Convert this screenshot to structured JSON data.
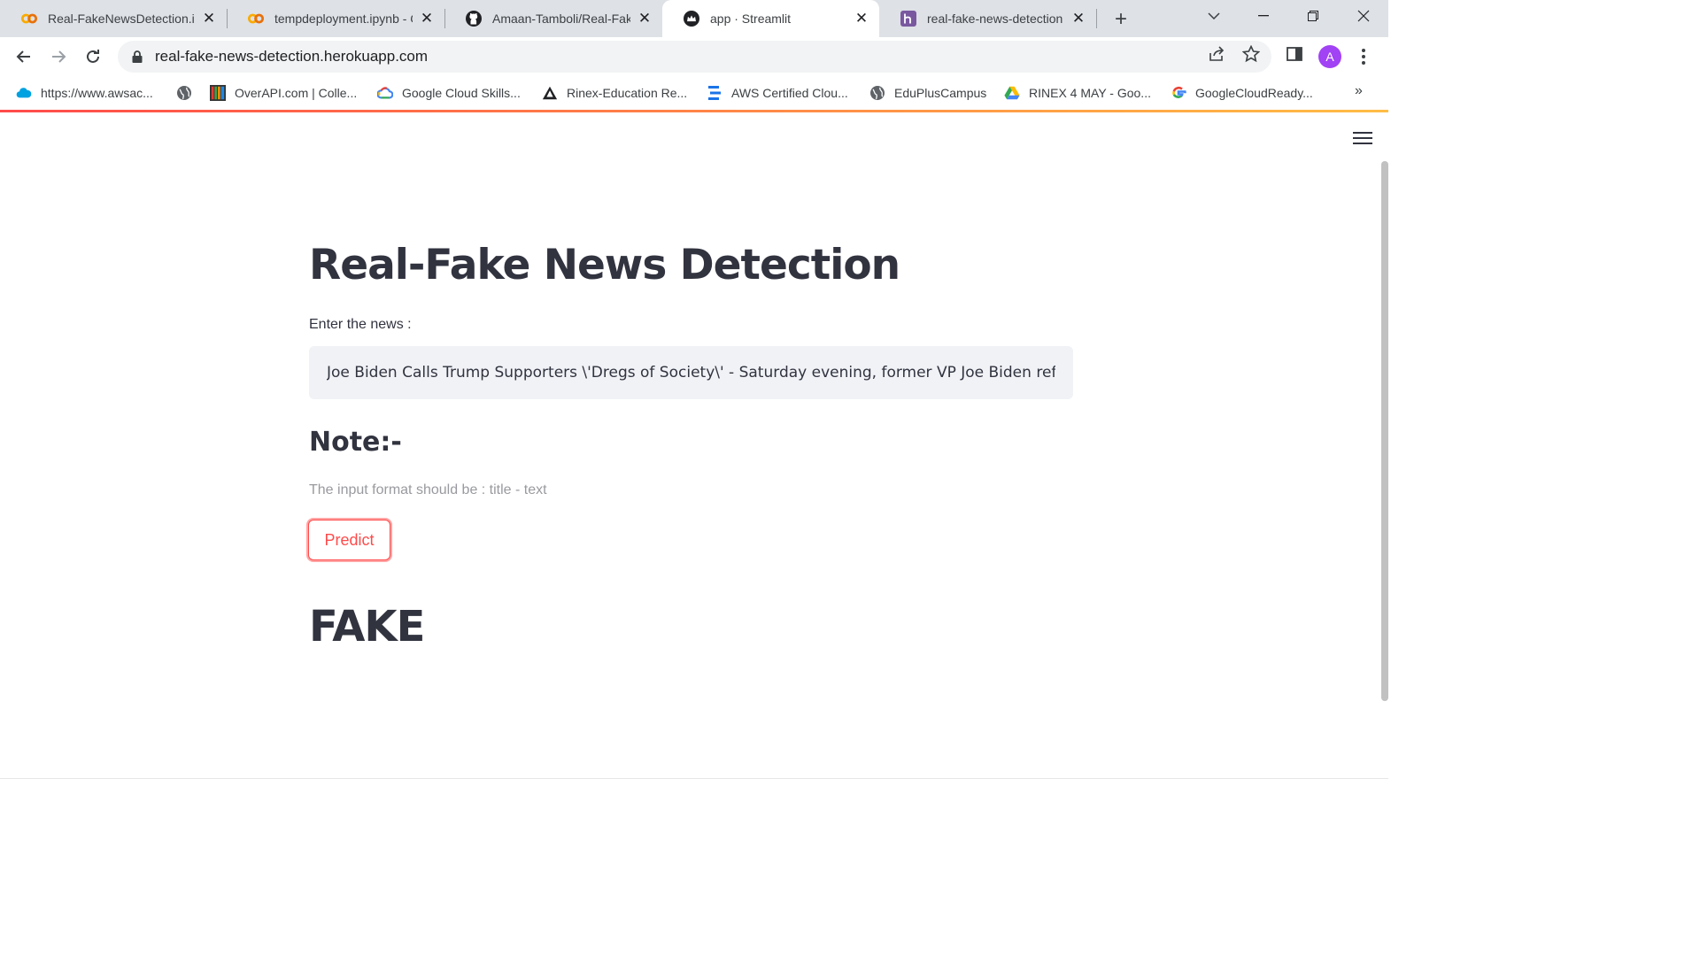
{
  "browser": {
    "tabs": [
      {
        "title": "Real-FakeNewsDetection.i",
        "icon": "colab-icon"
      },
      {
        "title": "tempdeployment.ipynb - C",
        "icon": "colab-icon"
      },
      {
        "title": "Amaan-Tamboli/Real-Fake",
        "icon": "github-icon"
      },
      {
        "title": "app · Streamlit",
        "icon": "streamlit-icon",
        "active": true
      },
      {
        "title": "real-fake-news-detection",
        "icon": "heroku-icon"
      }
    ],
    "url": "real-fake-news-detection.herokuapp.com",
    "profile_initial": "A",
    "bookmarks": [
      {
        "label": "https://www.awsac...",
        "icon": "cloud-icon"
      },
      {
        "label": "",
        "icon": "globe-icon"
      },
      {
        "label": "OverAPI.com | Colle...",
        "icon": "overapi-icon"
      },
      {
        "label": "Google Cloud Skills...",
        "icon": "google-cloud-icon"
      },
      {
        "label": "Rinex-Education Re...",
        "icon": "rinex-icon"
      },
      {
        "label": "AWS Certified Clou...",
        "icon": "aws-icon"
      },
      {
        "label": "EduPlusCampus",
        "icon": "globe-icon"
      },
      {
        "label": "RINEX 4 MAY - Goo...",
        "icon": "drive-icon"
      },
      {
        "label": "GoogleCloudReady...",
        "icon": "google-icon"
      }
    ],
    "colors": {
      "accent": "#ff4b4b",
      "text": "#31333f",
      "input_bg": "#f0f2f6",
      "avatar": "#a142f4"
    }
  },
  "app": {
    "title": "Real-Fake News Detection",
    "input_label": "Enter the news :",
    "input_value": "Joe Biden Calls Trump Supporters \\'Dregs of Society\\' - Saturday evening, former VP Joe Biden referre",
    "note_heading": "Note:-",
    "note_text": "The input format should be : title - text",
    "predict_label": "Predict",
    "result": "FAKE"
  }
}
